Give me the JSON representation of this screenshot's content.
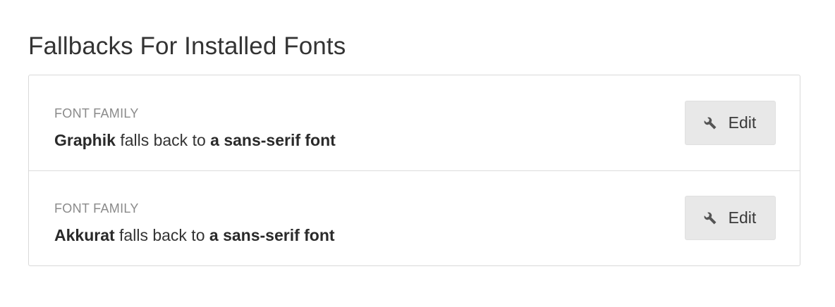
{
  "section": {
    "title": "Fallbacks For Installed Fonts"
  },
  "rows": [
    {
      "label": "FONT FAMILY",
      "font_name": "Graphik",
      "connector": "falls back to",
      "fallback": "a sans-serif font",
      "edit_label": "Edit"
    },
    {
      "label": "FONT FAMILY",
      "font_name": "Akkurat",
      "connector": "falls back to",
      "fallback": "a sans-serif font",
      "edit_label": "Edit"
    }
  ],
  "icons": {
    "edit_icon": "wrench-icon"
  }
}
